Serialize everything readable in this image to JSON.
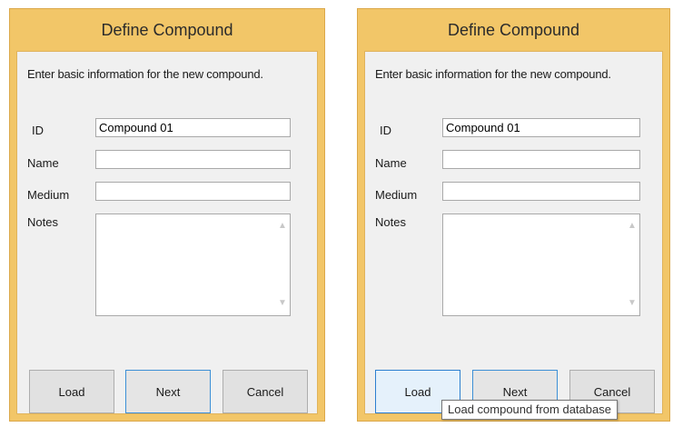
{
  "dialogs": [
    {
      "title": "Define Compound",
      "instructions": "Enter basic information for the new compound.",
      "fields": {
        "id_label": "ID",
        "id_value": "Compound 01",
        "name_label": "Name",
        "name_value": "",
        "medium_label": "Medium",
        "medium_value": "",
        "notes_label": "Notes",
        "notes_value": ""
      },
      "buttons": {
        "load": "Load",
        "next": "Next",
        "cancel": "Cancel"
      }
    },
    {
      "title": "Define Compound",
      "instructions": "Enter basic information for the new compound.",
      "fields": {
        "id_label": "ID",
        "id_value": "Compound 01",
        "name_label": "Name",
        "name_value": "",
        "medium_label": "Medium",
        "medium_value": "",
        "notes_label": "Notes",
        "notes_value": ""
      },
      "buttons": {
        "load": "Load",
        "next": "Next",
        "cancel": "Cancel"
      }
    }
  ],
  "tooltip": {
    "text": "Load compound from database"
  },
  "icons": {
    "scroll_up": "scroll-up-arrow-icon",
    "scroll_down": "scroll-down-arrow-icon"
  },
  "colors": {
    "title_bar": "#f2c668",
    "client_background": "#f0f0f0",
    "focus_border": "#3c8fd6",
    "hover_background": "#e5f1fb"
  }
}
